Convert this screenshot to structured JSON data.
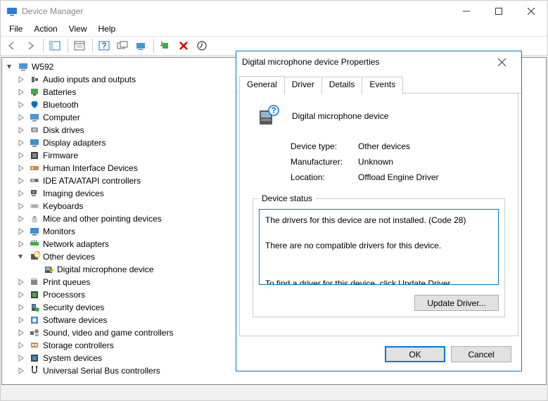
{
  "window": {
    "title": "Device Manager"
  },
  "menu": {
    "file": "File",
    "action": "Action",
    "view": "View",
    "help": "Help"
  },
  "tree": {
    "root": "W592",
    "items": [
      "Audio inputs and outputs",
      "Batteries",
      "Bluetooth",
      "Computer",
      "Disk drives",
      "Display adapters",
      "Firmware",
      "Human Interface Devices",
      "IDE ATA/ATAPI controllers",
      "Imaging devices",
      "Keyboards",
      "Mice and other pointing devices",
      "Monitors",
      "Network adapters",
      "Other devices",
      "Print queues",
      "Processors",
      "Security devices",
      "Software devices",
      "Sound, video and game controllers",
      "Storage controllers",
      "System devices",
      "Universal Serial Bus controllers"
    ],
    "other_child": "Digital microphone device"
  },
  "dialog": {
    "title": "Digital microphone device Properties",
    "tabs": {
      "general": "General",
      "driver": "Driver",
      "details": "Details",
      "events": "Events"
    },
    "device_name": "Digital microphone device",
    "device_type_label": "Device type:",
    "device_type": "Other devices",
    "manufacturer_label": "Manufacturer:",
    "manufacturer": "Unknown",
    "location_label": "Location:",
    "location": "Offload Engine Driver",
    "status_legend": "Device status",
    "status_text": "The drivers for this device are not installed. (Code 28)\n\nThere are no compatible drivers for this device.\n\n\nTo find a driver for this device, click Update Driver.",
    "update_driver": "Update Driver...",
    "ok": "OK",
    "cancel": "Cancel"
  }
}
